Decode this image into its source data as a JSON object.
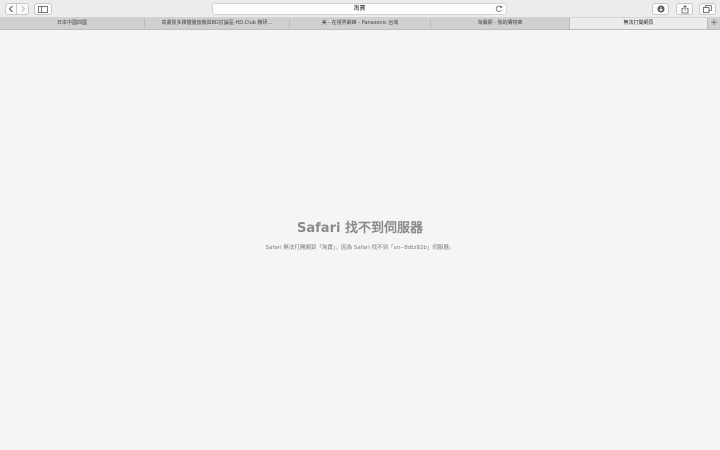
{
  "address_bar": {
    "text": "淘寶"
  },
  "tabs": [
    {
      "label": "日本中國四國"
    },
    {
      "label": "高畫質多媒體播放機與BD討論區-HD.Club 精研…"
    },
    {
      "label": "美 - 在視界巔峰 - Panasonic 台灣"
    },
    {
      "label": "淘寶網 - 我的購物車"
    },
    {
      "label": "無法打開網頁"
    }
  ],
  "active_tab_index": 4,
  "new_tab_label": "+",
  "error": {
    "title": "Safari 找不到伺服器",
    "message": "Safari 無法打開網頁「淘寶」，因為 Safari 找不到「xn--8dtz92b」伺服器。"
  },
  "icons": {
    "back": "chevron-left-icon",
    "forward": "chevron-right-icon",
    "sidebar": "sidebar-icon",
    "reload": "reload-icon",
    "download": "download-icon",
    "share": "share-icon",
    "tabs": "tab-overview-icon"
  }
}
